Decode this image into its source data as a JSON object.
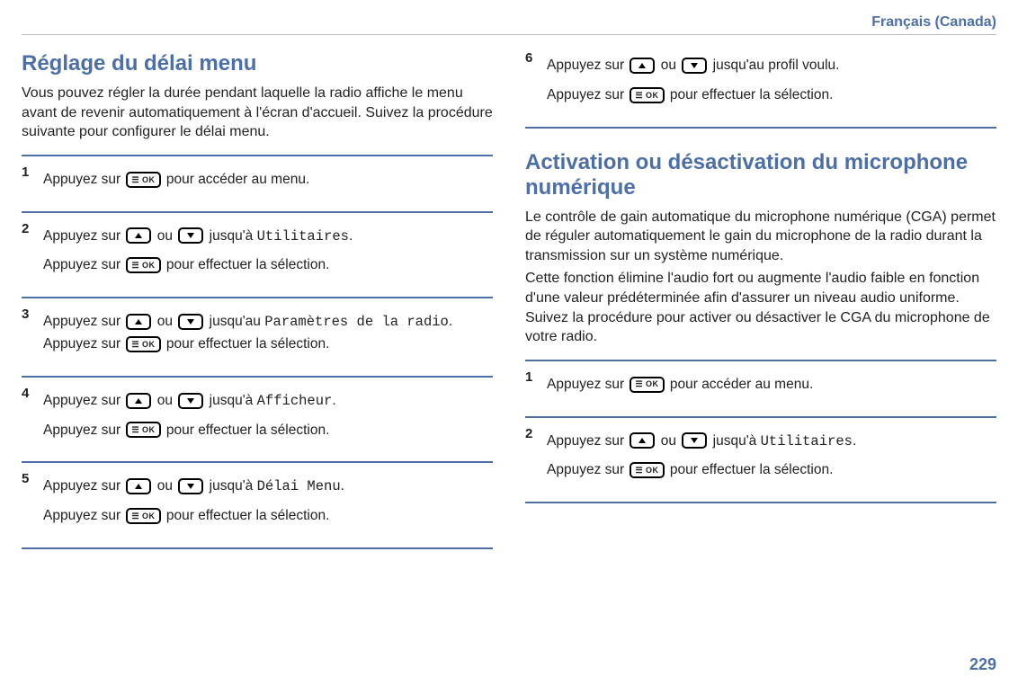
{
  "header": {
    "language": "Français (Canada)"
  },
  "page_number": "229",
  "icons": {
    "ok_label": "☰ OK"
  },
  "left": {
    "title": "Réglage du délai menu",
    "intro": "Vous pouvez régler la durée pendant laquelle la radio affiche le menu avant de revenir automatiquement à l'écran d'accueil. Suivez la procédure suivante pour configurer le délai menu.",
    "steps": {
      "s1": {
        "num": "1",
        "t1a": "Appuyez sur ",
        "t1b": " pour accéder au menu."
      },
      "s2": {
        "num": "2",
        "t1a": "Appuyez sur ",
        "t1b": " ou ",
        "t1c": " jusqu'à ",
        "target": "Utilitaires",
        "t1d": ".",
        "t2a": "Appuyez sur ",
        "t2b": " pour effectuer la sélection."
      },
      "s3": {
        "num": "3",
        "t1a": "Appuyez sur ",
        "t1b": " ou ",
        "t1c": " jusqu'au ",
        "target": "Paramètres de la radio",
        "t1d": ". Appuyez sur ",
        "t1e": " pour effectuer la sélection."
      },
      "s4": {
        "num": "4",
        "t1a": "Appuyez sur ",
        "t1b": " ou ",
        "t1c": " jusqu'à ",
        "target": "Afficheur",
        "t1d": ".",
        "t2a": "Appuyez sur ",
        "t2b": " pour effectuer la sélection."
      },
      "s5": {
        "num": "5",
        "t1a": "Appuyez sur ",
        "t1b": " ou ",
        "t1c": " jusqu'à ",
        "target": "Délai Menu",
        "t1d": ".",
        "t2a": "Appuyez sur ",
        "t2b": " pour effectuer la sélection."
      }
    }
  },
  "right_top": {
    "steps": {
      "s6": {
        "num": "6",
        "t1a": "Appuyez sur ",
        "t1b": " ou ",
        "t1c": " jusqu'au profil voulu.",
        "t2a": "Appuyez sur ",
        "t2b": " pour effectuer la sélection."
      }
    }
  },
  "right": {
    "title": "Activation ou désactivation du microphone numérique",
    "intro1": "Le contrôle de gain automatique du microphone numérique (CGA) permet de réguler automatiquement le gain du microphone de la radio durant la transmission sur un système numérique.",
    "intro2": "Cette fonction élimine l'audio fort ou augmente l'audio faible en fonction d'une valeur prédéterminée afin d'assurer un niveau audio uniforme. Suivez la procédure pour activer ou désactiver le CGA du microphone de votre radio.",
    "steps": {
      "s1": {
        "num": "1",
        "t1a": "Appuyez sur ",
        "t1b": " pour accéder au menu."
      },
      "s2": {
        "num": "2",
        "t1a": "Appuyez sur ",
        "t1b": " ou ",
        "t1c": " jusqu'à ",
        "target": "Utilitaires",
        "t1d": ".",
        "t2a": "Appuyez sur ",
        "t2b": " pour effectuer la sélection."
      }
    }
  }
}
